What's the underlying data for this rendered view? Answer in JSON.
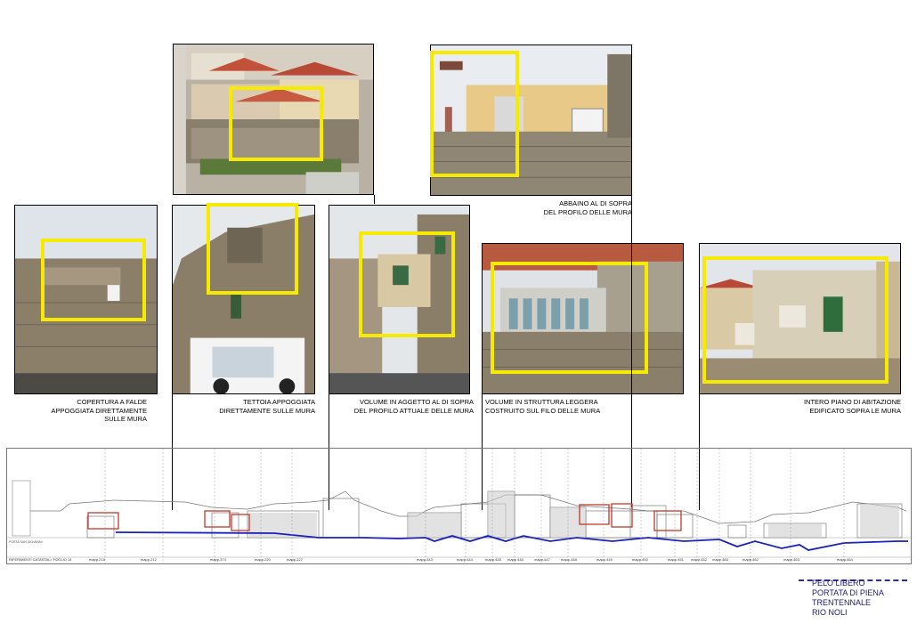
{
  "captions": {
    "c1": "COPERTURA A FALDE\nAPPOGGIATA DIRETTAMENTE\nSULLE MURA",
    "c2": "TETTOIA APPOGGIATA\nDIRETTAMENTE SULLE MURA",
    "c3": "VOLUME IN AGGETTO AL DI SOPRA\nDEL PROFILO ATTUALE DELLE MURA",
    "c4": "VOLUME IN STRUTTURA LEGGERA\nCOSTRUITO SUL FILO DELLE MURA",
    "c5": "INTERO PIANO DI ABITAZIONE\nEDIFICATO SOPRA LE MURA",
    "c6": "ABBAINO AL DI SOPRA\nDEL PROFILO DELLE MURA"
  },
  "legend": {
    "line1": "PELO LIBERO",
    "line2": "PORTATA DI PIENA",
    "line3": "TRENTENNALE",
    "line4": "RIO NOLI"
  },
  "elevation": {
    "label_left": "RIFERIMENTI CATASTALI: FOGLIO 14",
    "porta": "PORTA SAN GIOVANNI",
    "parcels": [
      "mapp.215",
      "mapp.212",
      "mapp.374",
      "mapp.220",
      "mapp.227",
      "mapp.443",
      "mapp.444",
      "mapp.445",
      "mapp.446",
      "mapp.447",
      "mapp.448",
      "mapp.449",
      "mapp.450",
      "mapp.451",
      "mapp.452",
      "mapp.460",
      "mapp.462",
      "mapp.463",
      "mapp.464"
    ]
  },
  "colors": {
    "highlight": "#f5ea00",
    "marker": "#c0392b",
    "water": "#1a22b8"
  }
}
